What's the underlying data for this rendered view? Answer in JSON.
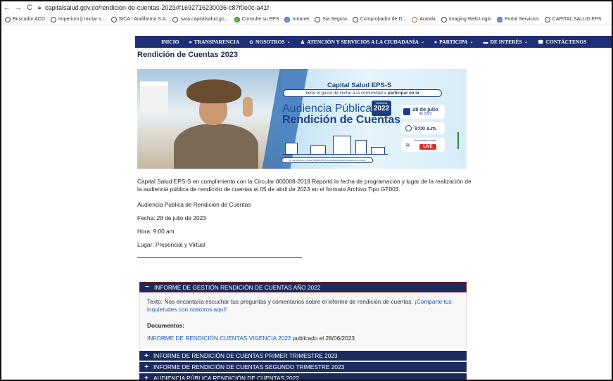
{
  "browser": {
    "url": "capitalsalud.gov.co/rendicion-de-cuentas-2023/#1692716230036-c87f0e0c-a41f",
    "bookmarks": [
      "Buscador ACD",
      "Imperium || Iniciar s...",
      "SICA - Audifarma S.A.",
      "sara.capitalsalud.go...",
      "Consulte su EPS",
      "Intranet",
      "Sia Segura",
      "Comprobador de D...",
      "Aranda",
      "Imaging Web Login",
      "Portal Servicios",
      "CAPITAL SALUD EPS"
    ]
  },
  "nav": {
    "items": [
      "INICIO",
      "TRANSPARENCIA",
      "NOSOTROS",
      "ATENCIÓN Y SERVICIOS A LA CIUDADANÍA",
      "PARTICIPA",
      "DE INTERÉS",
      "CONTÁCTENOS"
    ]
  },
  "page": {
    "title": "Rendición de Cuentas 2023",
    "banner": {
      "org": "Capital Salud EPS-S",
      "invite_1": "tiene el gusto de invitar a la comunidad a ",
      "invite_2": "participar en la",
      "audiencia": "Audiencia Pública",
      "rendicion": "Rendición de Cuentas",
      "vigencia": "VIGENCIA",
      "year": "2022",
      "date": "28 de julio",
      "date_year": "de 2023",
      "time": "9:00 a.m.",
      "transmision": "Transmisión virtual",
      "live": "LIVE",
      "footnote": "En cumplimiento Circular 000008-2018 de la Superintendencia Nacional de Salud"
    },
    "paragraph": "Capital Salud EPS-S en cumplimiento con la Circular 000008-2018 Reportó la fecha de programación y lugar de la realización de la audiencia pública de rendición de cuentas el 05 de abril de 2023 en el formato Archivo Tipo GT003.",
    "aud_title": "Audiencia Publica de Rendición de Cuentas",
    "fecha": "Fecha: 28 de julio de 2023",
    "hora": "Hora: 9:00 am",
    "lugar": "Lugar: Presencial y Virtual"
  },
  "accordion": {
    "open": {
      "sign": "−",
      "title": "INFORME DE GESTIÓN RENDICIÓN DE CUENTAS AÑO 2022",
      "text": "Texto: Nos encantaría escuchar tus preguntas y comentarios sobre el informe de rendición de cuentas. ",
      "link_text": "¡Comparte tus inquietudes con nosotros aquí!",
      "docs_label": "Documentos:",
      "doc_link": "INFORME DE RENDICIÓN CUENTAS VIGENCIA 2022",
      "doc_suffix": " publicado el 28/06/2023"
    },
    "collapsed": [
      {
        "sign": "+",
        "title": "INFORME DE RENDICIÓN DE CUENTAS PRIMER TRIMESTRE 2023"
      },
      {
        "sign": "+",
        "title": "INFORME DE RENDICIÓN DE CUENTAS SEGUNDO TRIMESTRE 2023"
      },
      {
        "sign": "+",
        "title": "AUDIENCIA PÚBLICA RENDICIÓN DE CUENTAS 2022"
      }
    ]
  }
}
